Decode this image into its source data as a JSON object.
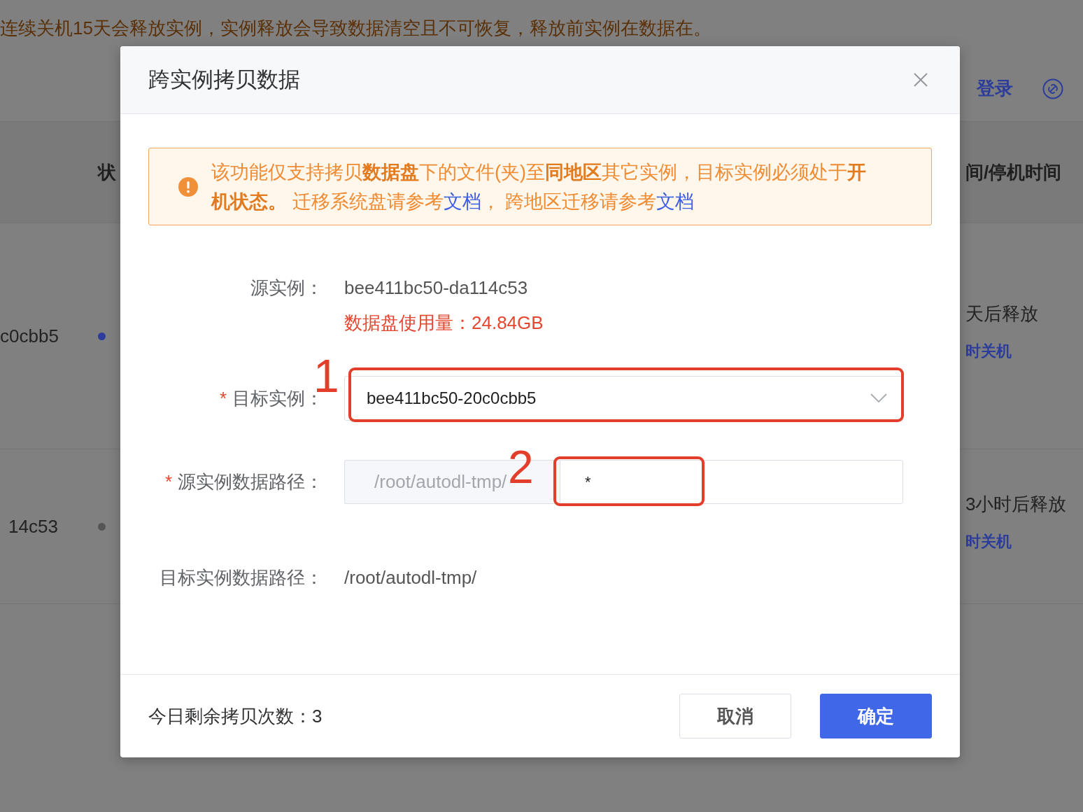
{
  "background": {
    "notice": "连续关机15天会释放实例，实例释放会导致数据清空且不可恢复，释放前实例在数据在。",
    "toolbar": {
      "link": "登录"
    },
    "table": {
      "column_2_heading": "状",
      "column_3_heading": "间/停机时间",
      "rows": [
        {
          "column_1": "c0cbb5",
          "color": "#2b3c9b",
          "column_3": "天后释放",
          "column_3_link": "时关机"
        },
        {
          "column_1": "14c53",
          "color": "#555555",
          "column_3": "3小时后释放",
          "column_3_link": "时关机"
        }
      ]
    }
  },
  "dialog": {
    "title": "跨实例拷贝数据",
    "alert": [
      {
        "kind": "text",
        "text": "该功能仅支持拷贝**数据盘**下的文件(夹)至**同地区**其它实例，目标实例必须处于**开机状态。** 迁移系统盘请参考"
      },
      {
        "kind": "link",
        "text": "文档"
      },
      {
        "kind": "text",
        "text": "， 跨地区迁移请参考"
      },
      {
        "kind": "link",
        "text": "文档"
      }
    ],
    "fields": [
      {
        "kind": "info",
        "label": "源实例：",
        "value": "bee411bc50-da114c53",
        "note": "数据盘使用量：24.84GB"
      },
      {
        "kind": "select",
        "required_mark": "*",
        "label": "目标实例：",
        "value": "bee411bc50-20c0cbb5",
        "marker": "1"
      },
      {
        "kind": "path-input",
        "required_mark": "*",
        "label": "源实例数据路径：",
        "prefix": "/root/autodl-tmp/",
        "value": "*",
        "marker": "2"
      },
      {
        "kind": "text",
        "label": "目标实例数据路径：",
        "value": "/root/autodl-tmp/"
      }
    ],
    "footer": {
      "remaining": "今日剩余拷贝次数：3",
      "buttons": [
        {
          "kind": "default",
          "label": "取消"
        },
        {
          "kind": "primary",
          "label": "确定"
        }
      ]
    }
  }
}
